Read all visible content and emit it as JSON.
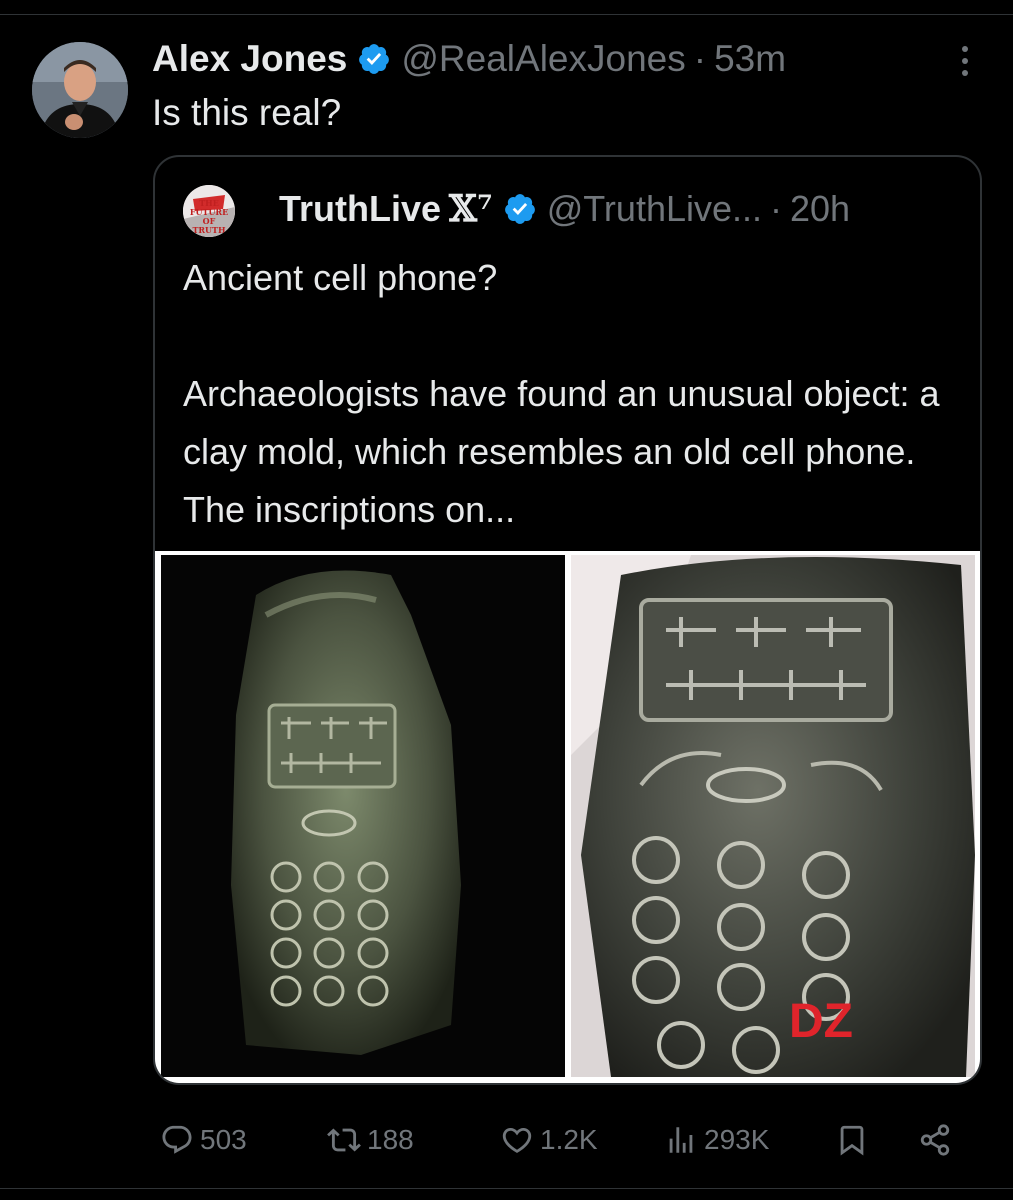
{
  "tweet": {
    "author_name": "Alex Jones",
    "handle": "@RealAlexJones",
    "separator": "·",
    "time": "53m",
    "text": "Is this real?"
  },
  "quote": {
    "avatar_text": "THE FUTURE OF TRUTH",
    "author_name": "TruthLive",
    "badge": "𝕏⁷",
    "handle": "@TruthLive...",
    "separator": "·",
    "time": "20h",
    "text": "Ancient cell phone?\n\nArchaeologists have found an unusual object: a clay mold, which resembles an old cell phone. The inscriptions on...",
    "watermark": "DZ"
  },
  "actions": {
    "replies": "503",
    "reposts": "188",
    "likes": "1.2K",
    "views": "293K"
  },
  "colors": {
    "background": "#000000",
    "text_primary": "#e7e9ea",
    "text_secondary": "#71767b",
    "verified_blue": "#1d9bf0",
    "border": "#2f3336"
  }
}
